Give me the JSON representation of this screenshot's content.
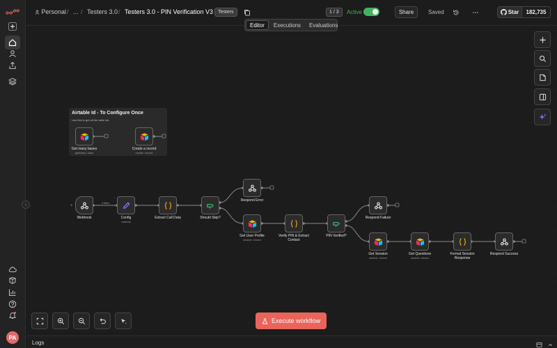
{
  "breadcrumb": {
    "project": "Personal",
    "ellipsis": "...",
    "folder": "Testers 3.0",
    "workflow": "Testers 3.0 - PIN Verification V3",
    "separator": "/"
  },
  "tag": "Testers",
  "pager": "1 / 3",
  "active_label": "Active",
  "active": true,
  "share_label": "Share",
  "saved_label": "Saved",
  "github": {
    "label": "Star",
    "count": "182,735"
  },
  "view_tabs": [
    {
      "label": "Editor",
      "selected": true
    },
    {
      "label": "Executions",
      "selected": false
    },
    {
      "label": "Evaluations",
      "selected": false
    }
  ],
  "sticky": {
    "title": "Airtable Id - To Configure Once",
    "subtitle": "Use this to get all the table ids"
  },
  "nodes": {
    "get_many_bases": {
      "label": "Get many bases",
      "sub": "getMany: base"
    },
    "create_record": {
      "label": "Create a record",
      "sub": "create: record"
    },
    "webhook": {
      "label": "Webhook"
    },
    "config": {
      "label": "Config",
      "sub": "manual"
    },
    "extract_call_data": {
      "label": "Extract Call Data"
    },
    "should_skip": {
      "label": "Should Skip?"
    },
    "respond_error": {
      "label": "Respond Error"
    },
    "get_user_profile": {
      "label": "Get User Profile",
      "sub": "search: record"
    },
    "verify_pin": {
      "label": "Verify PIN & Extract",
      "label2": "Contact"
    },
    "pin_verified": {
      "label": "PIN Verified?"
    },
    "respond_failure": {
      "label": "Respond Failure"
    },
    "get_session": {
      "label": "Get Session",
      "sub": "search: record"
    },
    "get_questions": {
      "label": "Get Questions",
      "sub": "search: record"
    },
    "format_session": {
      "label": "Format Session",
      "label2": "Response"
    },
    "respond_success": {
      "label": "Respond Success"
    }
  },
  "edge_label": "1 item",
  "execute_label": "Execute workflow",
  "logs_label": "Logs",
  "user_initials": "PA",
  "colors": {
    "accent": "#e9645b",
    "active_green": "#41b35d",
    "code_orange": "#f5a623",
    "if_green": "#3fbf7f",
    "ai_purple": "#9b6bff"
  }
}
